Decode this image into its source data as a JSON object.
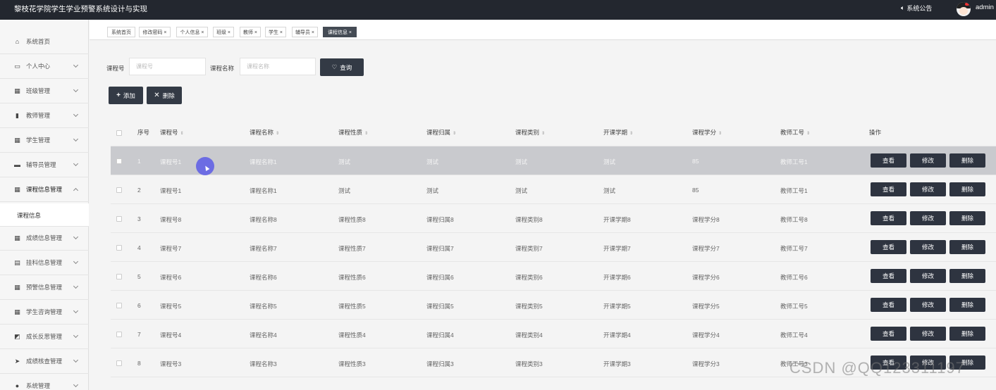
{
  "app": {
    "title": "黎枝花学院学生学业预警系统设计与实现",
    "notice_label": "系统公告",
    "username": "admin"
  },
  "sidebar": {
    "items": [
      {
        "label": "系统首页",
        "icon": "home-icon"
      },
      {
        "label": "个人中心",
        "icon": "profile-icon"
      },
      {
        "label": "班级管理",
        "icon": "grid-icon"
      },
      {
        "label": "教师管理",
        "icon": "clipboard-icon"
      },
      {
        "label": "学生管理",
        "icon": "grid-icon"
      },
      {
        "label": "辅导员管理",
        "icon": "monitor-icon"
      },
      {
        "label": "课程信息管理",
        "icon": "grid-icon"
      },
      {
        "label": "成绩信息管理",
        "icon": "grid-icon"
      },
      {
        "label": "挂科信息管理",
        "icon": "printer-icon"
      },
      {
        "label": "预警信息管理",
        "icon": "grid-icon"
      },
      {
        "label": "学生咨询管理",
        "icon": "grid-icon"
      },
      {
        "label": "成长反思管理",
        "icon": "chart-icon"
      },
      {
        "label": "成绩核查管理",
        "icon": "send-icon"
      },
      {
        "label": "系统管理",
        "icon": "user-icon"
      }
    ],
    "submenu_label": "课程信息"
  },
  "tabs": [
    {
      "label": "系统首页"
    },
    {
      "label": "修改密码 ×"
    },
    {
      "label": "个人信息 ×"
    },
    {
      "label": "班级 ×"
    },
    {
      "label": "教师 ×"
    },
    {
      "label": "学生 ×"
    },
    {
      "label": "辅导员 ×"
    },
    {
      "label": "课程信息 ×"
    }
  ],
  "search": {
    "course_no_label": "课程号",
    "course_no_placeholder": "课程号",
    "course_name_label": "课程名称",
    "course_name_placeholder": "课程名称",
    "query_label": "查询"
  },
  "toolbar": {
    "add_label": "添加",
    "delete_label": "删除"
  },
  "table": {
    "headers": {
      "index": "序号",
      "course_no": "课程号",
      "course_name": "课程名称",
      "nature": "课程性质",
      "belong": "课程归属",
      "category": "课程类别",
      "term": "开课学期",
      "credit": "课程学分",
      "teacher_no": "教师工号",
      "actions": "操作"
    },
    "sort_icon": "⇕",
    "action_labels": {
      "view": "查看",
      "edit": "修改",
      "delete": "删除"
    },
    "rows": [
      {
        "index": "1",
        "course_no": "课程号1",
        "course_name": "课程名称1",
        "nature": "测试",
        "belong": "测试",
        "category": "测试",
        "term": "测试",
        "credit": "85",
        "teacher_no": "教师工号1"
      },
      {
        "index": "2",
        "course_no": "课程号1",
        "course_name": "课程名称1",
        "nature": "测试",
        "belong": "测试",
        "category": "测试",
        "term": "测试",
        "credit": "85",
        "teacher_no": "教师工号1"
      },
      {
        "index": "3",
        "course_no": "课程号8",
        "course_name": "课程名称8",
        "nature": "课程性质8",
        "belong": "课程归属8",
        "category": "课程类别8",
        "term": "开课学期8",
        "credit": "课程学分8",
        "teacher_no": "教师工号8"
      },
      {
        "index": "4",
        "course_no": "课程号7",
        "course_name": "课程名称7",
        "nature": "课程性质7",
        "belong": "课程归属7",
        "category": "课程类别7",
        "term": "开课学期7",
        "credit": "课程学分7",
        "teacher_no": "教师工号7"
      },
      {
        "index": "5",
        "course_no": "课程号6",
        "course_name": "课程名称6",
        "nature": "课程性质6",
        "belong": "课程归属6",
        "category": "课程类别6",
        "term": "开课学期6",
        "credit": "课程学分6",
        "teacher_no": "教师工号6"
      },
      {
        "index": "6",
        "course_no": "课程号5",
        "course_name": "课程名称5",
        "nature": "课程性质5",
        "belong": "课程归属5",
        "category": "课程类别5",
        "term": "开课学期5",
        "credit": "课程学分5",
        "teacher_no": "教师工号5"
      },
      {
        "index": "7",
        "course_no": "课程号4",
        "course_name": "课程名称4",
        "nature": "课程性质4",
        "belong": "课程归属4",
        "category": "课程类别4",
        "term": "开课学期4",
        "credit": "课程学分4",
        "teacher_no": "教师工号4"
      },
      {
        "index": "8",
        "course_no": "课程号3",
        "course_name": "课程名称3",
        "nature": "课程性质3",
        "belong": "课程归属3",
        "category": "课程类别3",
        "term": "开课学期3",
        "credit": "课程学分3",
        "teacher_no": "教师工号3"
      }
    ]
  },
  "watermark": "CSDN @QQ123311197",
  "colors": {
    "topbar": "#23272f",
    "button_dark": "#333a45",
    "row_highlight": "#c9cace",
    "cursor": "#5c5ce6"
  }
}
